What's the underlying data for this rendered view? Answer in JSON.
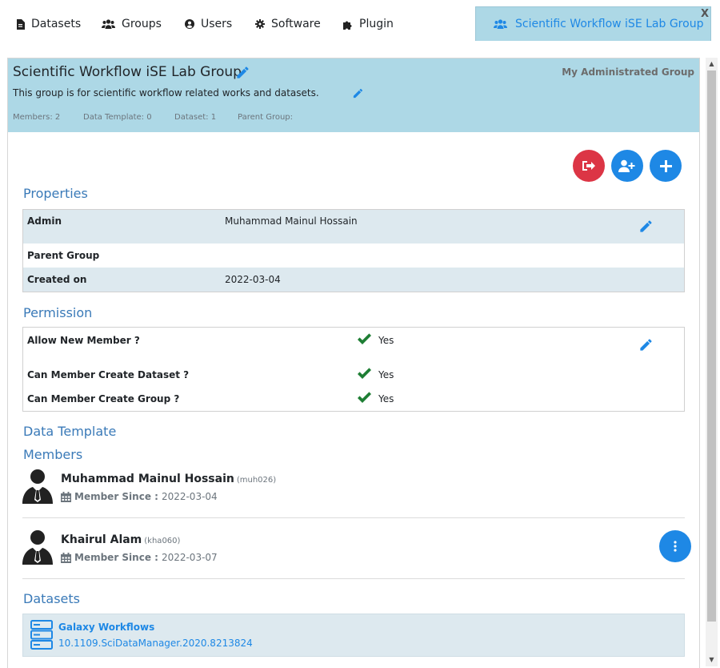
{
  "nav": {
    "items": [
      {
        "label": "Datasets",
        "icon": "file-icon"
      },
      {
        "label": "Groups",
        "icon": "users-icon"
      },
      {
        "label": "Users",
        "icon": "user-circle-icon"
      },
      {
        "label": "Software",
        "icon": "gear-icon"
      },
      {
        "label": "Plugin",
        "icon": "puzzle-icon"
      }
    ],
    "active_tab": "Scientific Workflow iSE Lab Group",
    "close_label": "X"
  },
  "group": {
    "title": "Scientific Workflow iSE Lab Group",
    "description": "This group is for scientific workflow related works and datasets.",
    "badge": "My Administrated Group",
    "stats": {
      "members": "Members: 2",
      "data_template": "Data Template: 0",
      "dataset": "Dataset: 1",
      "parent_group": "Parent Group:"
    }
  },
  "sections": {
    "properties": "Properties",
    "permission": "Permission",
    "data_template": "Data Template",
    "members": "Members",
    "datasets": "Datasets"
  },
  "properties": [
    {
      "label": "Admin",
      "value": "Muhammad Mainul Hossain"
    },
    {
      "label": "Parent Group",
      "value": ""
    },
    {
      "label": "Created on",
      "value": "2022-03-04"
    }
  ],
  "permissions": [
    {
      "label": "Allow New Member ?",
      "value": "Yes"
    },
    {
      "label": "Can Member Create Dataset ?",
      "value": "Yes"
    },
    {
      "label": "Can Member Create Group ?",
      "value": "Yes"
    }
  ],
  "members": [
    {
      "name": "Muhammad Mainul Hossain",
      "username": "(muh026)",
      "since_label": "Member Since :",
      "since": "2022-03-04"
    },
    {
      "name": "Khairul Alam",
      "username": "(kha060)",
      "since_label": "Member Since :",
      "since": "2022-03-07"
    }
  ],
  "datasets": [
    {
      "title": "Galaxy Workflows",
      "doi": "10.1109.SciDataManager.2020.8213824"
    }
  ],
  "colors": {
    "accent": "#1e88e5",
    "danger": "#dc3545",
    "header_bg": "#add8e6",
    "row_shade": "#dde9ef",
    "check": "#1e7e34",
    "section_title": "#3a7ab8"
  }
}
